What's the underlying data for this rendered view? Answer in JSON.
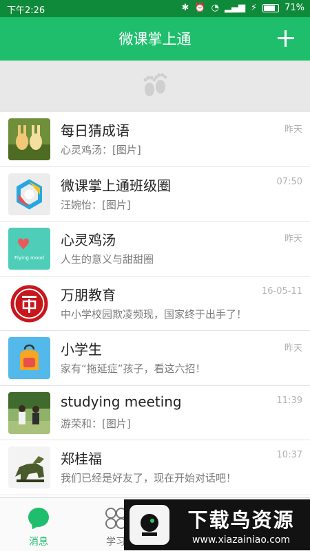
{
  "status_bar": {
    "time": "下午2:26",
    "battery_percent": "71%"
  },
  "header": {
    "title": "微课掌上通"
  },
  "conversations": [
    {
      "name": "每日猜成语",
      "preview": "心灵鸡汤：[图片]",
      "time": "昨天"
    },
    {
      "name": "微课掌上通班级圈",
      "preview": "汪婉怡：[图片]",
      "time": "07:50"
    },
    {
      "name": "心灵鸡汤",
      "preview": "人生的意义与甜甜圈",
      "time": "昨天",
      "avatar_text": "Flying mood"
    },
    {
      "name": "万朋教育",
      "preview": "中小学校园欺凌频现，国家终于出手了！",
      "time": "16-05-11"
    },
    {
      "name": "小学生",
      "preview": "家有“拖延症”孩子，看这六招！",
      "time": "昨天"
    },
    {
      "name": "studying meeting",
      "preview": "游荣和：[图片]",
      "time": "11:39"
    },
    {
      "name": "郑桂福",
      "preview": "我们已经是好友了，现在开始对话吧！",
      "time": "10:37"
    }
  ],
  "tabs": [
    {
      "label": "消息",
      "active": true
    },
    {
      "label": "学习",
      "active": false
    }
  ],
  "watermark": {
    "title": "下载鸟资源",
    "url": "www.xiazainiao.com"
  },
  "colors": {
    "brand_green": "#1fbe6d",
    "status_green": "#0f8a3a"
  }
}
